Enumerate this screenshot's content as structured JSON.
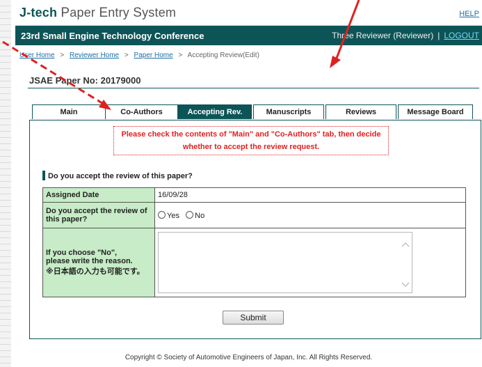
{
  "header": {
    "logo": {
      "j": "J-",
      "tech": "tech",
      "p": "P",
      "aper": "aper",
      "e": "E",
      "ntry": "ntry",
      "s": "S",
      "ystem": "ystem"
    },
    "help_label": "HELP"
  },
  "conference": {
    "title": "23rd Small Engine Technology Conference",
    "user": "Three Reviewer (Reviewer)",
    "separator": "|",
    "logout_label": "LOGOUT"
  },
  "breadcrumb": {
    "items": [
      "User Home",
      "Reviewer Home",
      "Paper Home"
    ],
    "current": "Accepting Review(Edit)",
    "separator": ">"
  },
  "paper": {
    "number_label": "JSAE Paper No: 20179000"
  },
  "tabs": [
    {
      "label": "Main"
    },
    {
      "label": "Co-Authors"
    },
    {
      "label": "Accepting Rev."
    },
    {
      "label": "Manuscripts"
    },
    {
      "label": "Reviews"
    },
    {
      "label": "Message Board"
    }
  ],
  "notice": {
    "line1": "Please check the contents of \"Main\" and \"Co-Authors\" tab, then decide",
    "line2": "whether to accept the review request."
  },
  "question": {
    "heading": "Do you accept the review of this paper?",
    "assigned_date_label": "Assigned Date",
    "assigned_date_value": "16/09/28",
    "accept_label_1": "Do you accept the review of",
    "accept_label_2": "this paper?",
    "yes_label": "Yes",
    "no_label": "No",
    "reason_label_1": "If you choose \"No\",",
    "reason_label_2": "please write the reason.",
    "reason_label_3": "※日本語の入力も可能です。",
    "reason_value": ""
  },
  "submit_label": "Submit",
  "footer": {
    "copyright": "Copyright © Society of Automotive Engineers of Japan, Inc. All Rights Reserved."
  },
  "colors": {
    "brand": "#0d5457",
    "label_bg": "#c7ecc7",
    "notice": "#e02020",
    "link": "#1d6ea5",
    "annotation": "#e02020"
  }
}
